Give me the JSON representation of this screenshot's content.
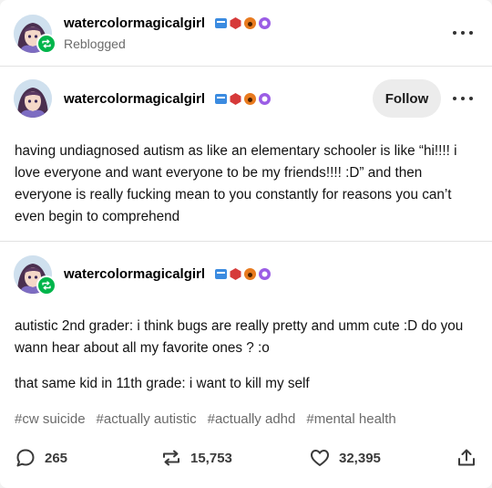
{
  "reblog_header": {
    "username": "watercolormagicalgirl",
    "status": "Reblogged"
  },
  "original_post": {
    "username": "watercolormagicalgirl",
    "follow_label": "Follow",
    "text": "having undiagnosed autism as like an elementary schooler is like “hi!!!! i love everyone and want everyone to be my friends!!!! :D” and then everyone is really fucking mean to you constantly for reasons you can’t even begin to comprehend"
  },
  "reblog_post": {
    "username": "watercolormagicalgirl",
    "paragraph_1": "autistic 2nd grader: i think bugs are really pretty and umm cute :D do you wann hear about all my favorite ones ? :o",
    "paragraph_2": "that same kid in 11th grade: i want to kill my self"
  },
  "tags": [
    "#cw suicide",
    "#actually autistic",
    "#actually adhd",
    "#mental health"
  ],
  "footer": {
    "replies": "265",
    "reblogs": "15,753",
    "likes": "32,395"
  },
  "colors": {
    "reblog_green": "#00b54b",
    "badge_blue": "#3b8be0",
    "badge_red": "#d63a3a",
    "badge_orange": "#e87a1e",
    "badge_purple": "#9b5de5"
  },
  "icons": [
    "reblog-icon",
    "more-options-icon",
    "reply-icon",
    "reblog-count-icon",
    "heart-icon",
    "share-icon"
  ]
}
